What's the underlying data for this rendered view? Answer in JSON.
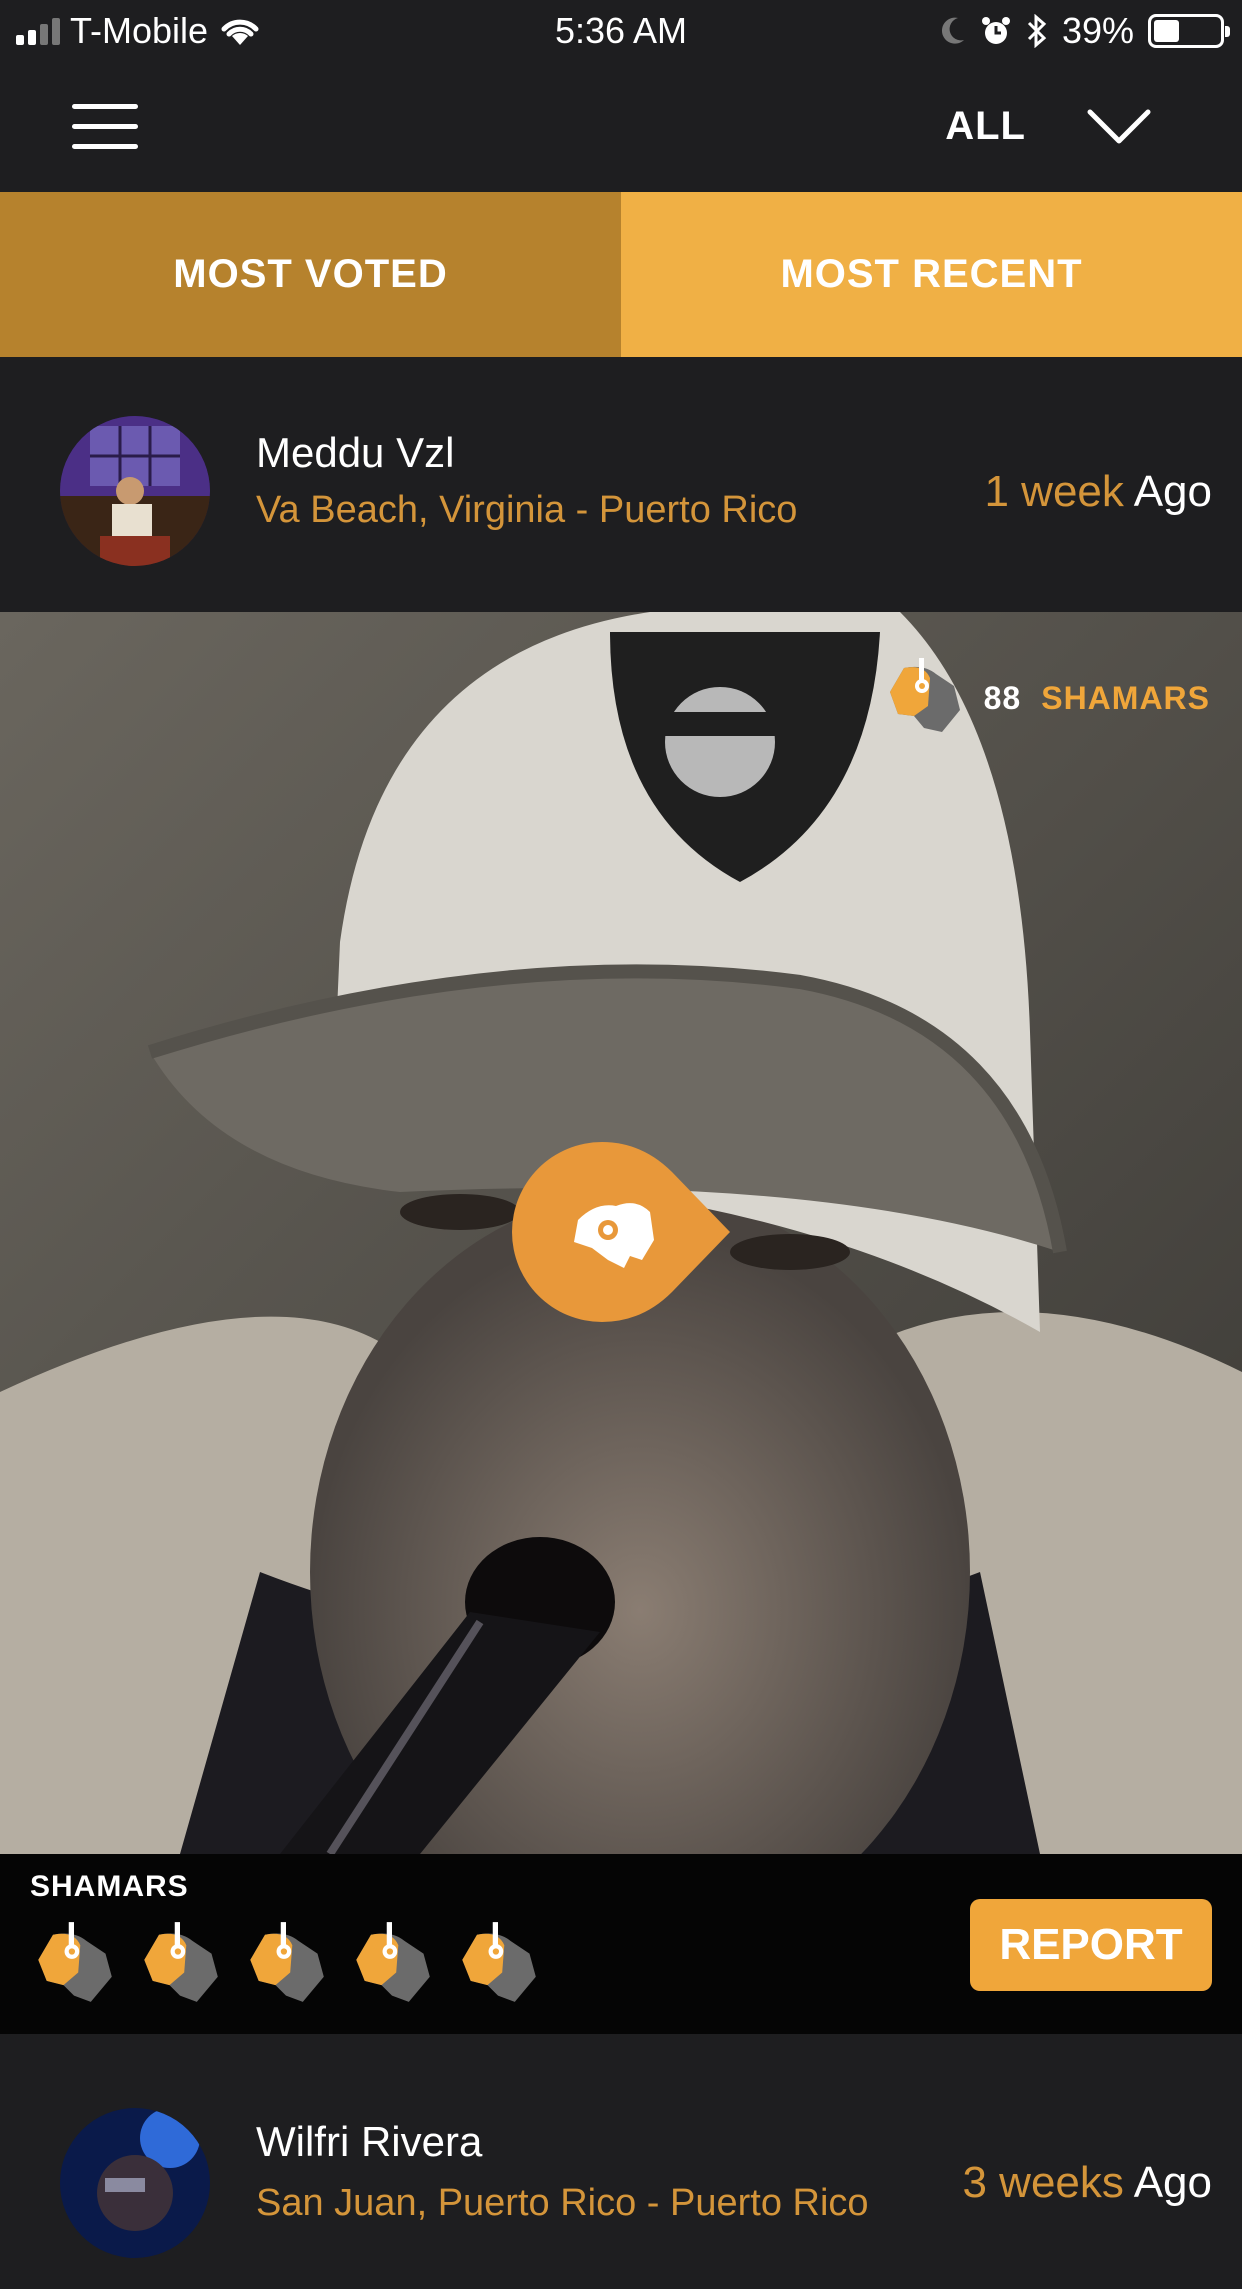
{
  "status_bar": {
    "carrier": "T-Mobile",
    "time": "5:36 AM",
    "battery": "39%",
    "battery_level": 0.39
  },
  "header": {
    "filter_label": "ALL"
  },
  "tabs": [
    {
      "label": "MOST VOTED",
      "active": false
    },
    {
      "label": "MOST RECENT",
      "active": true
    }
  ],
  "posts": [
    {
      "name": "Meddu Vzl",
      "location": "Va Beach, Virginia - Puerto Rico",
      "time_amount": "1 week",
      "time_suffix": "Ago",
      "shamars_count": "88",
      "shamars_word": "SHAMARS",
      "shamars_title": "SHAMARS",
      "report_label": "REPORT"
    },
    {
      "name": "Wilfri Rivera",
      "location": "San Juan, Puerto Rico - Puerto Rico",
      "time_amount": "3 weeks",
      "time_suffix": "Ago"
    }
  ],
  "colors": {
    "background": "#1e1e20",
    "accent": "#f0a63a",
    "tab_active": "#f0b045",
    "tab_inactive": "#b6822d",
    "location": "#d4953a"
  },
  "icons": [
    "signal-icon",
    "wifi-icon",
    "moon-icon",
    "alarm-icon",
    "bluetooth-icon",
    "battery-icon",
    "menu-icon",
    "chevron-down-icon",
    "shamar-icon",
    "play-shamar-icon"
  ]
}
